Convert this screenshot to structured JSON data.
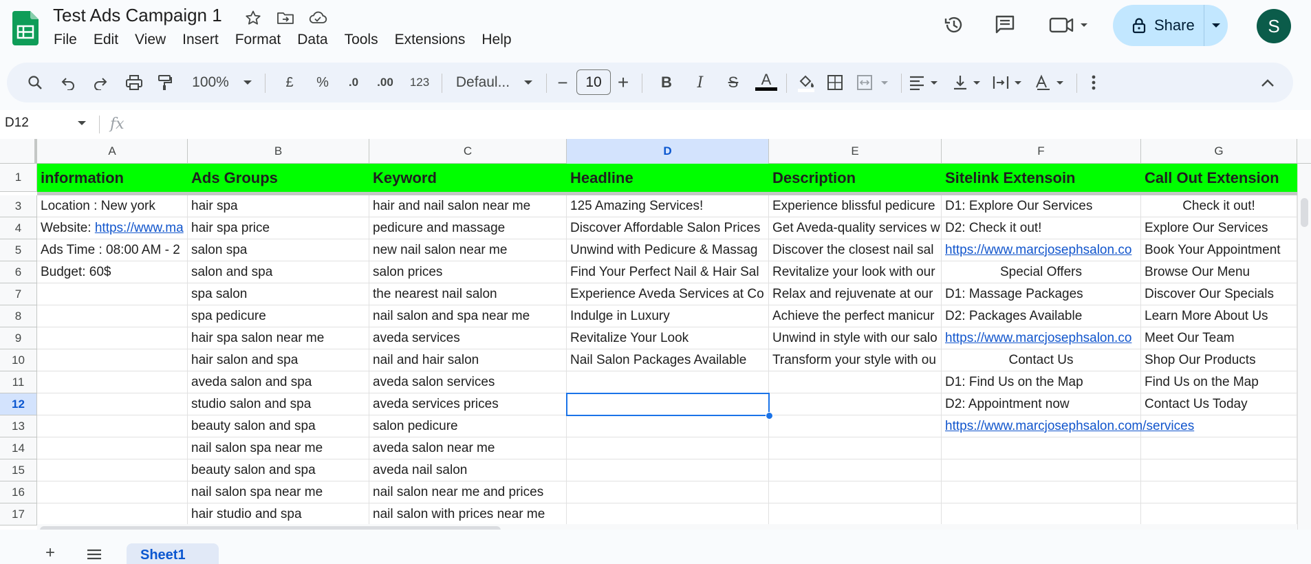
{
  "doc": {
    "title": "Test Ads Campaign 1",
    "menu": [
      "File",
      "Edit",
      "View",
      "Insert",
      "Format",
      "Data",
      "Tools",
      "Extensions",
      "Help"
    ]
  },
  "header": {
    "share_label": "Share",
    "avatar_initial": "S"
  },
  "toolbar": {
    "zoom": "100%",
    "currency": "£",
    "percent": "%",
    "decrease_decimal": ".0",
    "increase_decimal": ".00",
    "number_format": "123",
    "font": "Defaul...",
    "font_size": "10",
    "minus": "−",
    "plus": "+",
    "bold": "B",
    "italic": "I",
    "strike": "S",
    "text_color": "A"
  },
  "formula_bar": {
    "name_box": "D12",
    "fx": "fx",
    "value": ""
  },
  "grid": {
    "selected_cell": "D12",
    "columns": [
      "A",
      "B",
      "C",
      "D",
      "E",
      "F",
      "G"
    ],
    "header_row": {
      "row": "1",
      "cells": [
        "information",
        "Ads Groups",
        "Keyword",
        "Headline",
        "Description",
        "Sitelink Extensoin",
        "Call Out Extension"
      ]
    },
    "rows": [
      {
        "row": "3",
        "cells": [
          "Location : New york",
          "hair spa",
          "hair and nail salon near me",
          "125 Amazing Services!",
          "Experience blissful pedicure",
          "D1: Explore Our Services",
          "Check it out!"
        ]
      },
      {
        "row": "4",
        "cells": [
          "Website: https://www.ma",
          "hair spa price",
          "pedicure and massage",
          "Discover Affordable Salon Prices",
          "Get Aveda-quality services w",
          "D2: Check it out!",
          "Explore Our Services"
        ]
      },
      {
        "row": "5",
        "cells": [
          "Ads Time : 08:00 AM - 2",
          "salon spa",
          "new nail salon near me",
          "Unwind with Pedicure & Massag",
          "Discover the closest nail sal",
          "https://www.marcjosephsalon.co",
          "Book Your Appointment"
        ]
      },
      {
        "row": "6",
        "cells": [
          "Budget: 60$",
          "salon and spa",
          "salon prices",
          "Find Your Perfect Nail & Hair Sal",
          "Revitalize your look with our",
          "Special Offers",
          "Browse Our Menu"
        ]
      },
      {
        "row": "7",
        "cells": [
          "",
          "spa salon",
          "the nearest nail salon",
          "Experience Aveda Services at Co",
          "Relax and rejuvenate at our",
          "D1: Massage Packages",
          "Discover Our Specials"
        ]
      },
      {
        "row": "8",
        "cells": [
          "",
          "spa pedicure",
          "nail salon and spa near me",
          "Indulge in Luxury",
          "Achieve the perfect manicur",
          "D2: Packages Available",
          "Learn More About Us"
        ]
      },
      {
        "row": "9",
        "cells": [
          "",
          "hair spa salon near me",
          "aveda services",
          "Revitalize Your Look",
          "Unwind in style with our salo",
          "https://www.marcjosephsalon.co",
          "Meet Our Team"
        ]
      },
      {
        "row": "10",
        "cells": [
          "",
          "hair salon and spa",
          "nail and hair salon",
          "Nail Salon Packages Available",
          "Transform your style with ou",
          "Contact Us",
          "Shop Our Products"
        ]
      },
      {
        "row": "11",
        "cells": [
          "",
          "aveda salon and spa",
          "aveda salon services",
          "",
          "",
          "D1: Find Us on the Map",
          "Find Us on the Map"
        ]
      },
      {
        "row": "12",
        "cells": [
          "",
          "studio salon and spa",
          "aveda services prices",
          "",
          "",
          "D2: Appointment now",
          "Contact Us Today"
        ]
      },
      {
        "row": "13",
        "cells": [
          "",
          "beauty salon and spa",
          "salon pedicure",
          "",
          "",
          "https://www.marcjosephsalon.com/services",
          ""
        ]
      },
      {
        "row": "14",
        "cells": [
          "",
          "nail salon spa near me",
          "aveda salon near me",
          "",
          "",
          "",
          ""
        ]
      },
      {
        "row": "15",
        "cells": [
          "",
          "beauty salon and spa",
          "aveda nail salon",
          "",
          "",
          "",
          ""
        ]
      },
      {
        "row": "16",
        "cells": [
          "",
          "nail salon spa near me",
          "nail salon near me and prices",
          "",
          "",
          "",
          ""
        ]
      },
      {
        "row": "17",
        "cells": [
          "",
          "hair studio and spa",
          "nail salon with prices near me",
          "",
          "",
          "",
          ""
        ]
      }
    ],
    "link_prefix_A4": "Website: ",
    "link_text_A4": "https://www.ma"
  },
  "sheets": {
    "add": "+",
    "tabs": [
      "Sheet1"
    ]
  },
  "colors": {
    "header_fill": "#00ff00",
    "link": "#1155cc",
    "selection": "#1a73e8",
    "share_bg": "#c2e7ff"
  },
  "icons": [
    "sheets-logo-icon",
    "star-icon",
    "move-folder-icon",
    "cloud-saved-icon",
    "history-icon",
    "comment-icon",
    "meet-video-icon",
    "lock-icon",
    "search-icon",
    "undo-icon",
    "redo-icon",
    "print-icon",
    "paint-format-icon",
    "fill-color-icon",
    "borders-icon",
    "merge-cells-icon",
    "align-left-icon",
    "vertical-align-icon",
    "text-wrap-icon",
    "text-rotate-icon",
    "more-vert-icon",
    "collapse-icon"
  ]
}
